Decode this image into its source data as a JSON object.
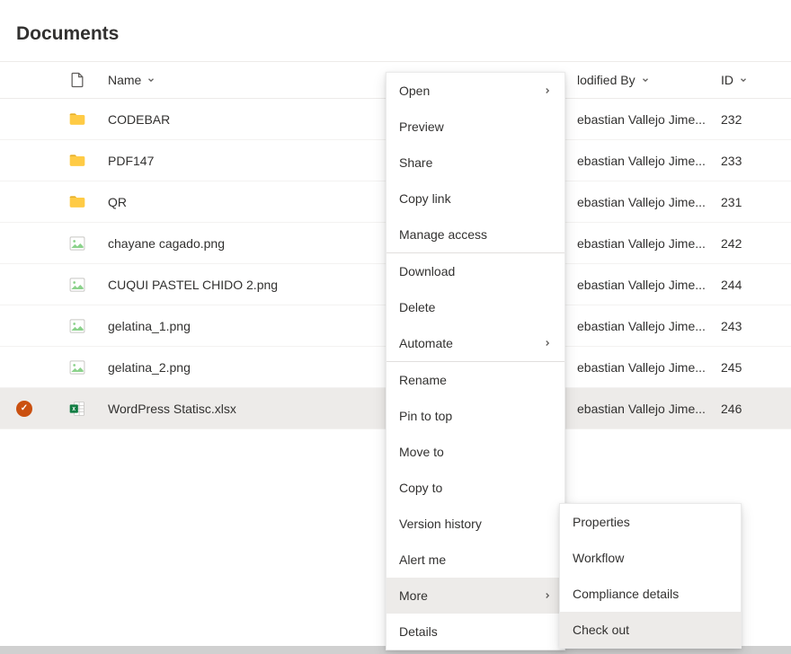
{
  "title": "Documents",
  "columns": {
    "name": "Name",
    "modifiedBy": "lodified By",
    "id": "ID"
  },
  "rows": [
    {
      "type": "folder",
      "name": "CODEBAR",
      "modifiedBy": "ebastian Vallejo Jime...",
      "id": "232",
      "selected": false
    },
    {
      "type": "folder",
      "name": "PDF147",
      "modifiedBy": "ebastian Vallejo Jime...",
      "id": "233",
      "selected": false
    },
    {
      "type": "folder",
      "name": "QR",
      "modifiedBy": "ebastian Vallejo Jime...",
      "id": "231",
      "selected": false
    },
    {
      "type": "image",
      "name": "chayane cagado.png",
      "modifiedBy": "ebastian Vallejo Jime...",
      "id": "242",
      "selected": false
    },
    {
      "type": "image",
      "name": "CUQUI PASTEL CHIDO 2.png",
      "modifiedBy": "ebastian Vallejo Jime...",
      "id": "244",
      "selected": false
    },
    {
      "type": "image",
      "name": "gelatina_1.png",
      "modifiedBy": "ebastian Vallejo Jime...",
      "id": "243",
      "selected": false
    },
    {
      "type": "image",
      "name": "gelatina_2.png",
      "modifiedBy": "ebastian Vallejo Jime...",
      "id": "245",
      "selected": false
    },
    {
      "type": "excel",
      "name": "WordPress Statisc.xlsx",
      "modifiedBy": "ebastian Vallejo Jime...",
      "id": "246",
      "selected": true
    }
  ],
  "menu": [
    {
      "label": "Open",
      "chevron": true
    },
    {
      "label": "Preview"
    },
    {
      "label": "Share"
    },
    {
      "label": "Copy link"
    },
    {
      "label": "Manage access"
    },
    {
      "sep": true
    },
    {
      "label": "Download"
    },
    {
      "label": "Delete"
    },
    {
      "label": "Automate",
      "chevron": true
    },
    {
      "sep": true
    },
    {
      "label": "Rename"
    },
    {
      "label": "Pin to top"
    },
    {
      "label": "Move to"
    },
    {
      "label": "Copy to"
    },
    {
      "label": "Version history"
    },
    {
      "label": "Alert me"
    },
    {
      "label": "More",
      "chevron": true,
      "highlight": true
    },
    {
      "label": "Details"
    }
  ],
  "submenu": [
    {
      "label": "Properties"
    },
    {
      "label": "Workflow"
    },
    {
      "label": "Compliance details"
    },
    {
      "label": "Check out",
      "highlight": true
    }
  ]
}
